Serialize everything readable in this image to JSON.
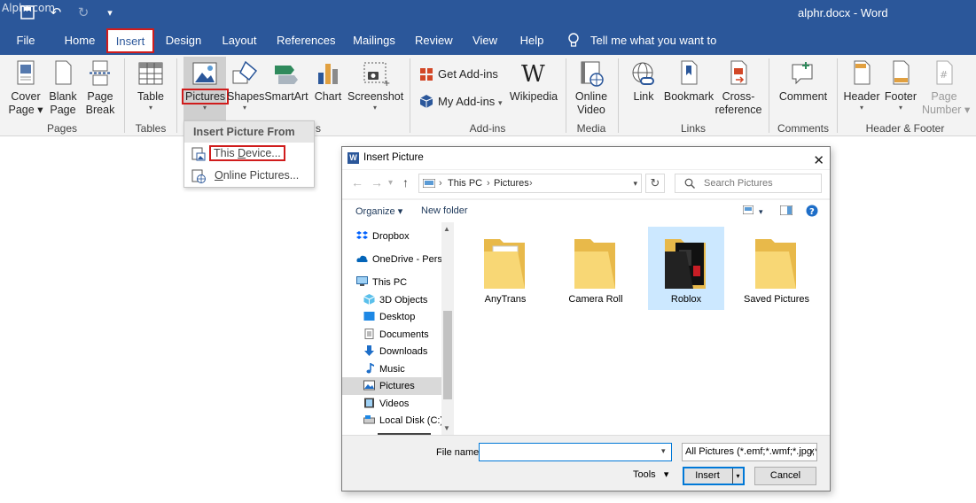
{
  "watermark": "Alphr.com",
  "window": {
    "doc_title": "alphr.docx  -  Word"
  },
  "tabs": [
    {
      "label": "File"
    },
    {
      "label": "Home"
    },
    {
      "label": "Insert"
    },
    {
      "label": "Design"
    },
    {
      "label": "Layout"
    },
    {
      "label": "References"
    },
    {
      "label": "Mailings"
    },
    {
      "label": "Review"
    },
    {
      "label": "View"
    },
    {
      "label": "Help"
    }
  ],
  "tell_me": "Tell me what you want to do",
  "ribbon": {
    "pages": {
      "cover_page": [
        "Cover",
        "Page"
      ],
      "blank_page": [
        "Blank",
        "Page"
      ],
      "page_break": [
        "Page",
        "Break"
      ],
      "group": "Pages"
    },
    "tables": {
      "table": "Table",
      "group": "Tables"
    },
    "illustrations": {
      "pictures": "Pictures",
      "shapes": "Shapes",
      "smartart": "SmartArt",
      "chart": "Chart",
      "screenshot": "Screenshot",
      "group_tail": "s"
    },
    "addins": {
      "get": "Get Add-ins",
      "my": "My Add-ins",
      "wikipedia": "Wikipedia",
      "group": "Add-ins"
    },
    "media": {
      "online_video": [
        "Online",
        "Video"
      ],
      "group": "Media"
    },
    "links": {
      "link": "Link",
      "bookmark": "Bookmark",
      "cross_ref": [
        "Cross-",
        "reference"
      ],
      "group": "Links"
    },
    "comments": {
      "comment": "Comment",
      "group": "Comments"
    },
    "header_footer": {
      "header": "Header",
      "footer": "Footer",
      "page_number": [
        "Page",
        "Number"
      ],
      "group": "Header & Footer"
    }
  },
  "dropdown": {
    "header": "Insert Picture From",
    "this_device_u": "D",
    "this_device_pre": "This ",
    "this_device_post": "evice...",
    "online_u": "O",
    "online_post": "nline Pictures..."
  },
  "dialog": {
    "title": "Insert Picture",
    "path": [
      "This PC",
      "Pictures"
    ],
    "search_placeholder": "Search Pictures",
    "organize": "Organize",
    "new_folder": "New folder",
    "nav": [
      {
        "label": "Dropbox"
      },
      {
        "label": "OneDrive - Person"
      },
      {
        "label": "This PC"
      },
      {
        "label": "3D Objects"
      },
      {
        "label": "Desktop"
      },
      {
        "label": "Documents"
      },
      {
        "label": "Downloads"
      },
      {
        "label": "Music"
      },
      {
        "label": "Pictures"
      },
      {
        "label": "Videos"
      },
      {
        "label": "Local Disk (C:)"
      }
    ],
    "folders": [
      {
        "label": "AnyTrans"
      },
      {
        "label": "Camera Roll"
      },
      {
        "label": "Roblox"
      },
      {
        "label": "Saved Pictures"
      }
    ],
    "file_name_label": "File name:",
    "file_name_value": "",
    "filter": "All Pictures (*.emf;*.wmf;*.jpg;*",
    "tools": "Tools",
    "insert": "Insert",
    "cancel": "Cancel"
  },
  "colors": {
    "accent": "#2b579a",
    "highlight": "#d01c1c",
    "selection": "#cce8ff"
  }
}
